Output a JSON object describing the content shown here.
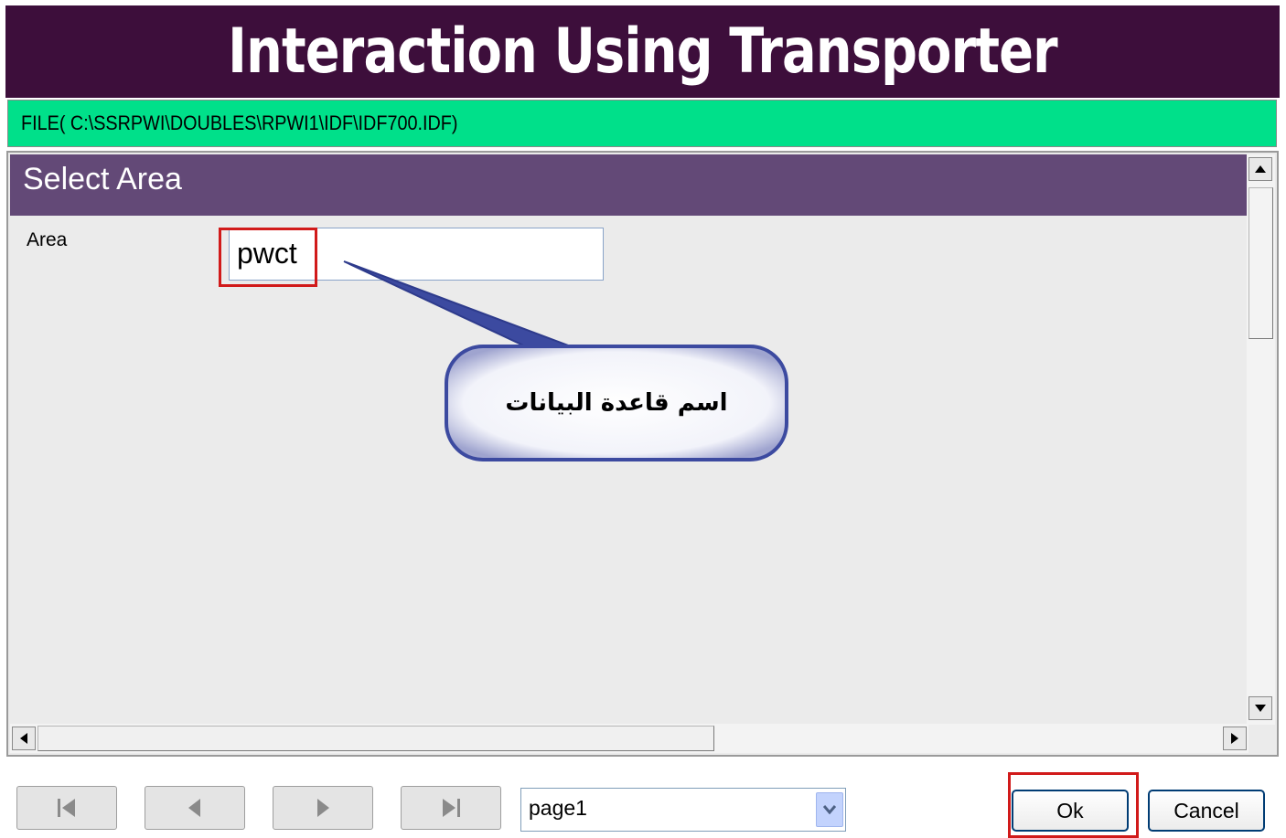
{
  "window": {
    "title": "Interaction Using Transporter"
  },
  "file_bar": {
    "text": "FILE( C:\\SSRPWI\\DOUBLES\\RPWI1\\IDF\\IDF700.IDF)"
  },
  "panel": {
    "title": "Select Area",
    "area_label": "Area",
    "area_value": "pwct"
  },
  "annotation": {
    "text": "اسم قاعدة البيانات",
    "highlight_color": "#d11a1a"
  },
  "pager": {
    "selected_page": "page1"
  },
  "buttons": {
    "ok": "Ok",
    "cancel": "Cancel"
  },
  "colors": {
    "title_bg": "#3d0e3b",
    "file_bar_bg": "#00e08a",
    "panel_header_bg": "#634977"
  }
}
